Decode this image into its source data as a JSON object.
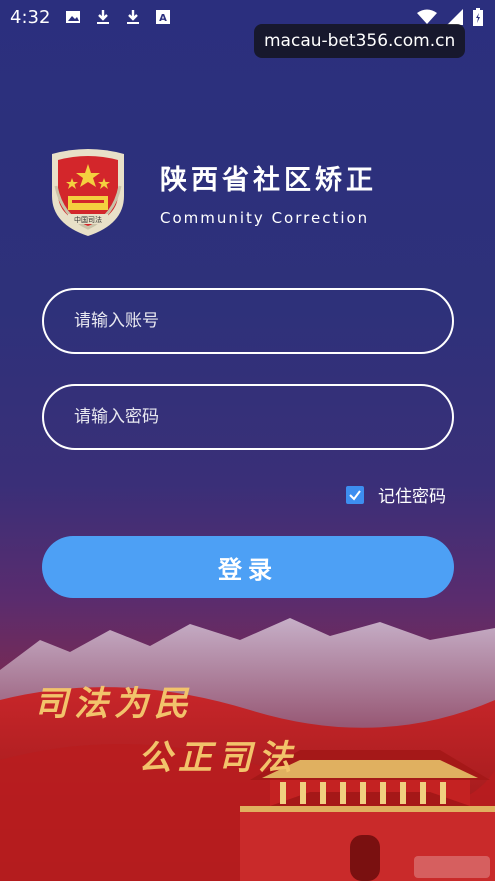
{
  "status_bar": {
    "time": "4:32",
    "icons": [
      "image-icon",
      "download-icon",
      "download-icon",
      "translate-icon"
    ],
    "right_icons": [
      "wifi-icon",
      "signal-icon",
      "battery-icon"
    ]
  },
  "watermark": {
    "text": "macau-bet356.com.cn"
  },
  "header": {
    "title_cn": "陕西省社区矫正",
    "title_en": "Community Correction",
    "emblem_text": "中国司法"
  },
  "form": {
    "username_placeholder": "请输入账号",
    "password_placeholder": "请输入密码",
    "remember_label": "记住密码",
    "remember_checked": true,
    "login_label": "登录"
  },
  "banner": {
    "slogan_line1": "司法为民",
    "slogan_line2": "公正司法"
  },
  "colors": {
    "button": "#4da0f5",
    "checkbox": "#3d8ef0",
    "slogan": "#f2c36b",
    "background_top": "#2b2f7e",
    "background_bottom": "#b52222"
  }
}
